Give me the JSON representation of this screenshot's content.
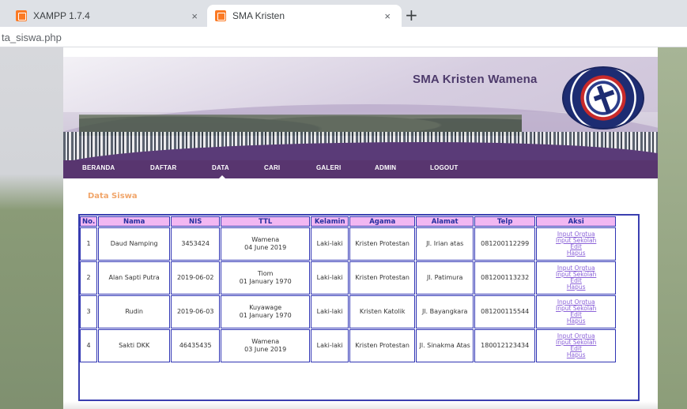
{
  "browser": {
    "tabs": [
      {
        "title": "XAMPP 1.7.4",
        "active": false
      },
      {
        "title": "SMA Kristen",
        "active": true
      }
    ],
    "close_glyph": "×",
    "new_tab_glyph": "+",
    "url": "ta_siswa.php"
  },
  "site": {
    "title": "SMA Kristen Wamena",
    "nav": [
      "BERANDA",
      "DAFTAR",
      "DATA",
      "CARI",
      "GALERI",
      "ADMIN",
      "LOGOUT"
    ],
    "active_nav": "DATA"
  },
  "content": {
    "section_title": "Data Siswa",
    "columns": [
      "No.",
      "Nama",
      "NIS",
      "TTL",
      "Kelamin",
      "Agama",
      "Alamat",
      "Telp",
      "Aksi"
    ],
    "rows": [
      {
        "no": "1",
        "nama": "Daud Namping",
        "nis": "3453424",
        "ttl_place": "Wamena",
        "ttl_date": "04 June 2019",
        "kelamin": "Laki-laki",
        "agama": "Kristen Protestan",
        "alamat": "Jl. Irian atas",
        "telp": "081200112299"
      },
      {
        "no": "2",
        "nama": "Alan Sapti Putra",
        "nis": "2019-06-02",
        "ttl_place": "Tiom",
        "ttl_date": "01 January 1970",
        "kelamin": "Laki-laki",
        "agama": "Kristen Protestan",
        "alamat": "Jl. Patimura",
        "telp": "081200113232"
      },
      {
        "no": "3",
        "nama": "Rudin",
        "nis": "2019-06-03",
        "ttl_place": "Kuyawage",
        "ttl_date": "01 January 1970",
        "kelamin": "Laki-laki",
        "agama": "Kristen Katolik",
        "alamat": "Jl. Bayangkara",
        "telp": "081200115544"
      },
      {
        "no": "4",
        "nama": "Sakti DKK",
        "nis": "46435435",
        "ttl_place": "Wamena",
        "ttl_date": "03 June 2019",
        "kelamin": "Laki-laki",
        "agama": "Kristen Protestan",
        "alamat": "Jl. Sinakma Atas",
        "telp": "180012123434"
      }
    ],
    "actions": [
      "Input Orgtua",
      "Input Sekolah",
      "Edit",
      "Hapus"
    ]
  },
  "colors": {
    "nav_bg": "#58356f",
    "title_color": "#4d3a6b",
    "section_title": "#f1a66b",
    "table_header_bg": "#f2b7f2",
    "table_border": "#2f34b4",
    "link": "#8b62d8"
  }
}
